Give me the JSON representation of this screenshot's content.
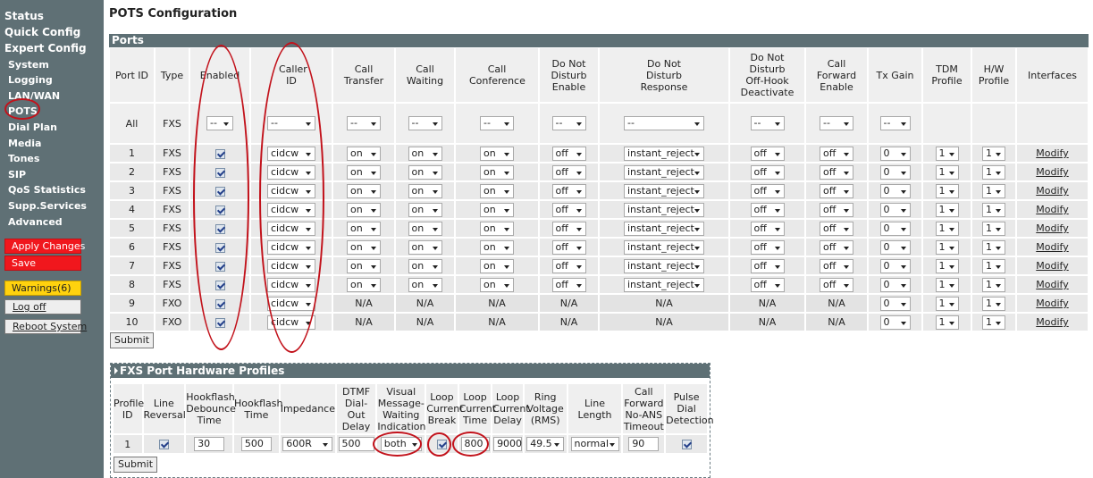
{
  "sidebar": {
    "top": [
      "Status",
      "Quick Config",
      "Expert Config"
    ],
    "sub": [
      "System",
      "Logging",
      "LAN/WAN",
      "POTS",
      "Dial Plan",
      "Media",
      "Tones",
      "SIP",
      "QoS Statistics",
      "Supp.Services",
      "Advanced"
    ],
    "apply": "Apply Changes",
    "save": "Save",
    "warnings": "Warnings(6)",
    "logoff": "Log off",
    "reboot": "Reboot System"
  },
  "page": {
    "title": "POTS Configuration",
    "section": "Ports",
    "submit": "Submit"
  },
  "columns": [
    "Port ID",
    "Type",
    "Enabled",
    "Caller ID",
    "Call Transfer",
    "Call Waiting",
    "Call Conference",
    "Do Not Disturb Enable",
    "Do Not Disturb Response",
    "Do Not Disturb Off-Hook Deactivate",
    "Call Forward Enable",
    "Tx Gain",
    "TDM Profile",
    "H/W Profile",
    "Interfaces"
  ],
  "all_row": {
    "id": "All",
    "type": "FXS",
    "enabled": "--",
    "caller_id": "--",
    "transfer": "--",
    "waiting": "--",
    "conference": "--",
    "dnd": "--",
    "dnd_resp": "--",
    "dnd_off": "--",
    "cfwd": "--",
    "txgain": "--"
  },
  "ports": [
    {
      "id": "1",
      "type": "FXS",
      "caller_id": "cidcw",
      "transfer": "on",
      "waiting": "on",
      "conference": "on",
      "dnd": "off",
      "dnd_resp": "instant_reject",
      "dnd_off": "off",
      "cfwd": "off",
      "txgain": "0",
      "tdm": "1",
      "hw": "1",
      "iface": "Modify"
    },
    {
      "id": "2",
      "type": "FXS",
      "caller_id": "cidcw",
      "transfer": "on",
      "waiting": "on",
      "conference": "on",
      "dnd": "off",
      "dnd_resp": "instant_reject",
      "dnd_off": "off",
      "cfwd": "off",
      "txgain": "0",
      "tdm": "1",
      "hw": "1",
      "iface": "Modify"
    },
    {
      "id": "3",
      "type": "FXS",
      "caller_id": "cidcw",
      "transfer": "on",
      "waiting": "on",
      "conference": "on",
      "dnd": "off",
      "dnd_resp": "instant_reject",
      "dnd_off": "off",
      "cfwd": "off",
      "txgain": "0",
      "tdm": "1",
      "hw": "1",
      "iface": "Modify"
    },
    {
      "id": "4",
      "type": "FXS",
      "caller_id": "cidcw",
      "transfer": "on",
      "waiting": "on",
      "conference": "on",
      "dnd": "off",
      "dnd_resp": "instant_reject",
      "dnd_off": "off",
      "cfwd": "off",
      "txgain": "0",
      "tdm": "1",
      "hw": "1",
      "iface": "Modify"
    },
    {
      "id": "5",
      "type": "FXS",
      "caller_id": "cidcw",
      "transfer": "on",
      "waiting": "on",
      "conference": "on",
      "dnd": "off",
      "dnd_resp": "instant_reject",
      "dnd_off": "off",
      "cfwd": "off",
      "txgain": "0",
      "tdm": "1",
      "hw": "1",
      "iface": "Modify"
    },
    {
      "id": "6",
      "type": "FXS",
      "caller_id": "cidcw",
      "transfer": "on",
      "waiting": "on",
      "conference": "on",
      "dnd": "off",
      "dnd_resp": "instant_reject",
      "dnd_off": "off",
      "cfwd": "off",
      "txgain": "0",
      "tdm": "1",
      "hw": "1",
      "iface": "Modify"
    },
    {
      "id": "7",
      "type": "FXS",
      "caller_id": "cidcw",
      "transfer": "on",
      "waiting": "on",
      "conference": "on",
      "dnd": "off",
      "dnd_resp": "instant_reject",
      "dnd_off": "off",
      "cfwd": "off",
      "txgain": "0",
      "tdm": "1",
      "hw": "1",
      "iface": "Modify"
    },
    {
      "id": "8",
      "type": "FXS",
      "caller_id": "cidcw",
      "transfer": "on",
      "waiting": "on",
      "conference": "on",
      "dnd": "off",
      "dnd_resp": "instant_reject",
      "dnd_off": "off",
      "cfwd": "off",
      "txgain": "0",
      "tdm": "1",
      "hw": "1",
      "iface": "Modify"
    },
    {
      "id": "9",
      "type": "FXO",
      "caller_id": "cidcw",
      "transfer": "N/A",
      "waiting": "N/A",
      "conference": "N/A",
      "dnd": "N/A",
      "dnd_resp": "N/A",
      "dnd_off": "N/A",
      "cfwd": "N/A",
      "txgain": "0",
      "tdm": "1",
      "hw": "1",
      "iface": "Modify"
    },
    {
      "id": "10",
      "type": "FXO",
      "caller_id": "cidcw",
      "transfer": "N/A",
      "waiting": "N/A",
      "conference": "N/A",
      "dnd": "N/A",
      "dnd_resp": "N/A",
      "dnd_off": "N/A",
      "cfwd": "N/A",
      "txgain": "0",
      "tdm": "1",
      "hw": "1",
      "iface": "Modify"
    }
  ],
  "hw": {
    "title": "FXS Port Hardware Profiles",
    "columns": [
      "Profile ID",
      "Line Reversal",
      "Hookflash Debounce Time",
      "Hookflash Time",
      "Impedance",
      "DTMF Dial-Out Delay",
      "Visual Message-Waiting Indication",
      "Loop Current Break",
      "Loop Current Time",
      "Loop Current Delay",
      "Ring Voltage (RMS)",
      "Line Length",
      "Call Forward No-ANS Timeout",
      "Pulse Dial Detection"
    ],
    "row": {
      "id": "1",
      "debounce": "30",
      "hookflash": "500",
      "impedance": "600R",
      "dtmf": "500",
      "vmwi": "both",
      "loop_time": "800",
      "loop_delay": "9000",
      "ring": "49.5",
      "length": "normal",
      "cfna": "90"
    },
    "submit": "Submit"
  },
  "colors": {
    "sidebar": "#5f7075",
    "header": "#5e7075",
    "highlight": "#c2121b",
    "apply": "#f0171d",
    "warnings": "#ffd20e"
  }
}
